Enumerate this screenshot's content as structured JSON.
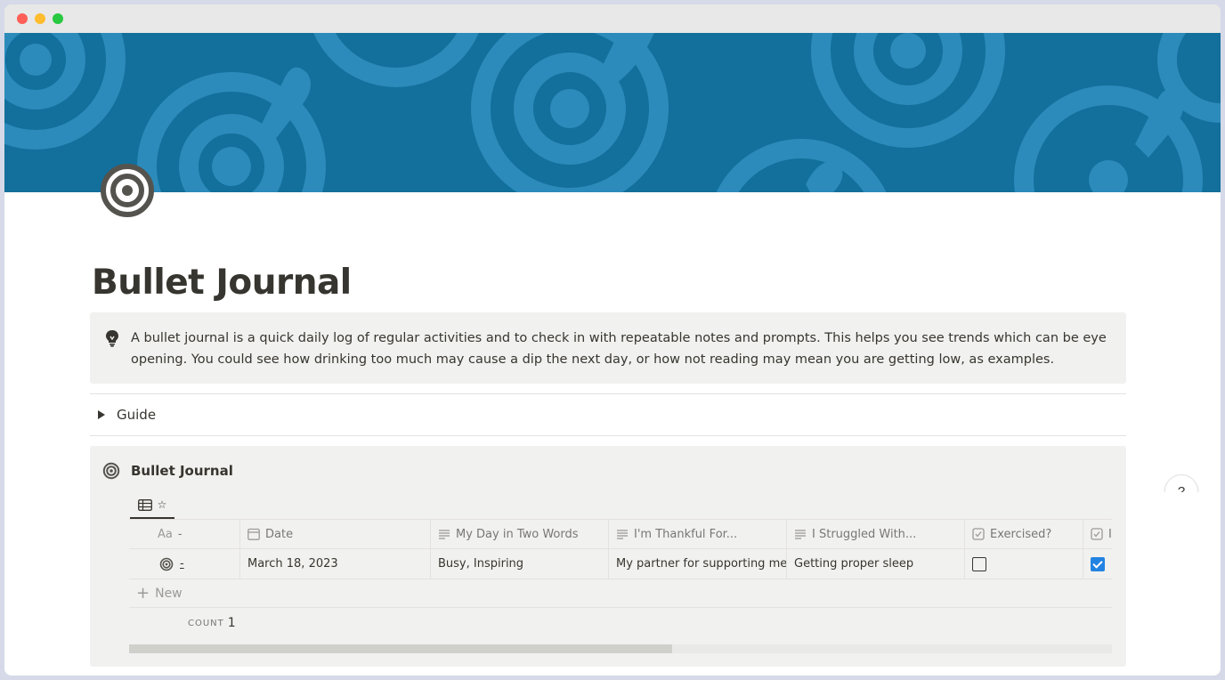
{
  "page": {
    "title": "Bullet Journal",
    "icon": "target-icon",
    "cover": "target-pattern-cover"
  },
  "callout": {
    "icon": "lightbulb-icon",
    "text": "A bullet journal is a quick daily log of regular activities and to check in with repeatable notes and prompts. This helps you see trends which can be eye opening. You could see how drinking too much may cause a dip the next day, or how not reading may mean you are getting low, as examples."
  },
  "toggle": {
    "label": "Guide"
  },
  "database": {
    "title": "Bullet Journal",
    "view_tab_label": "☆",
    "columns": [
      {
        "label": "-",
        "icon": "title-aa-icon"
      },
      {
        "label": "Date",
        "icon": "calendar-icon"
      },
      {
        "label": "My Day in Two Words",
        "icon": "text-lines-icon"
      },
      {
        "label": "I'm Thankful For...",
        "icon": "text-lines-icon"
      },
      {
        "label": "I Struggled With...",
        "icon": "text-lines-icon"
      },
      {
        "label": "Exercised?",
        "icon": "checkbox-icon"
      },
      {
        "label": "I",
        "icon": "checkbox-icon"
      }
    ],
    "rows": [
      {
        "name": "-",
        "date": "March 18, 2023",
        "two_words": "Busy, Inspiring",
        "thankful": "My partner for supporting me",
        "struggled": "Getting proper sleep",
        "exercised": false,
        "extra": true
      }
    ],
    "new_label": "New",
    "count_label": "COUNT",
    "count_value": "1"
  },
  "help": {
    "label": "?"
  },
  "colors": {
    "cover": "#136f9b",
    "accent": "#2383e2",
    "callout_bg": "#f1f1ef",
    "text": "#37352f"
  }
}
